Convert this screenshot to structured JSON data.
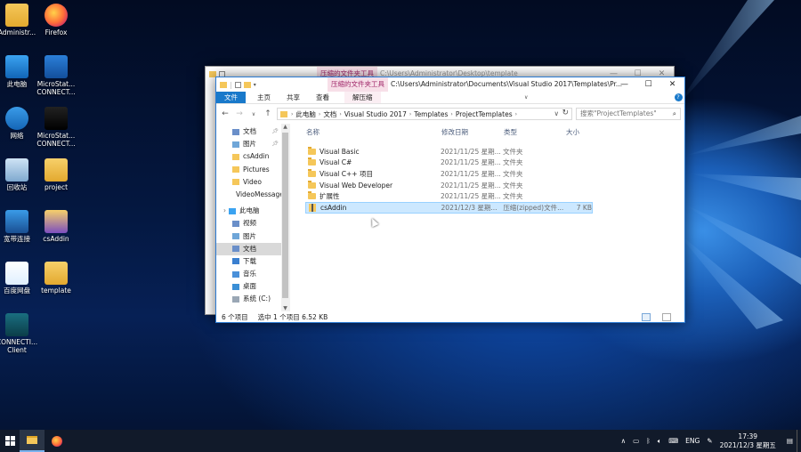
{
  "desktop": {
    "icons": [
      {
        "label": "Administr...",
        "icon": "user-folder-icon"
      },
      {
        "label": "Firefox",
        "icon": "firefox-icon"
      },
      {
        "label": "此电脑",
        "icon": "this-pc-icon"
      },
      {
        "label": "MicroStat... CONNECT...",
        "icon": "microstation-icon"
      },
      {
        "label": "网络",
        "icon": "network-icon"
      },
      {
        "label": "MicroStat... CONNECT...",
        "icon": "microstation-console-icon"
      },
      {
        "label": "回收站",
        "icon": "recycle-bin-icon"
      },
      {
        "label": "project",
        "icon": "folder-icon"
      },
      {
        "label": "宽带连接",
        "icon": "broadband-icon"
      },
      {
        "label": "csAddin",
        "icon": "zip-folder-icon"
      },
      {
        "label": "百度网盘",
        "icon": "baidu-netdisk-icon"
      },
      {
        "label": "template",
        "icon": "folder-icon"
      },
      {
        "label": "CONNECTI... Client",
        "icon": "connection-client-icon"
      }
    ]
  },
  "back_window": {
    "context_tab": "压缩的文件夹工具",
    "title": "C:\\Users\\Administrator\\Desktop\\template"
  },
  "explorer": {
    "context_tab": "压缩的文件夹工具",
    "title": "C:\\Users\\Administrator\\Documents\\Visual Studio 2017\\Templates\\Pr...",
    "controls": {
      "minimize": "—",
      "maximize": "☐",
      "close": "✕"
    },
    "ribbon_tabs": [
      "文件",
      "主页",
      "共享",
      "查看",
      "解压缩"
    ],
    "breadcrumb": [
      "此电脑",
      "文档",
      "Visual Studio 2017",
      "Templates",
      "ProjectTemplates"
    ],
    "search_placeholder": "搜索\"ProjectTemplates\"",
    "nav_items": [
      {
        "label": "文档",
        "pinned": true
      },
      {
        "label": "图片",
        "pinned": true
      },
      {
        "label": "csAddin",
        "pinned": false
      },
      {
        "label": "Pictures",
        "pinned": false
      },
      {
        "label": "Video",
        "pinned": false
      },
      {
        "label": "VideoMessage",
        "pinned": false
      },
      {
        "label": "此电脑",
        "pinned": false
      },
      {
        "label": "视频",
        "pinned": false
      },
      {
        "label": "图片",
        "pinned": false
      },
      {
        "label": "文档",
        "pinned": false
      },
      {
        "label": "下载",
        "pinned": false
      },
      {
        "label": "音乐",
        "pinned": false
      },
      {
        "label": "桌面",
        "pinned": false
      },
      {
        "label": "系统 (C:)",
        "pinned": false
      }
    ],
    "columns": [
      "名称",
      "修改日期",
      "类型",
      "大小"
    ],
    "files": [
      {
        "name": "Visual Basic",
        "date": "2021/11/25 星期...",
        "type": "文件夹",
        "size": ""
      },
      {
        "name": "Visual C#",
        "date": "2021/11/25 星期...",
        "type": "文件夹",
        "size": ""
      },
      {
        "name": "Visual C++ 项目",
        "date": "2021/11/25 星期...",
        "type": "文件夹",
        "size": ""
      },
      {
        "name": "Visual Web Developer",
        "date": "2021/11/25 星期...",
        "type": "文件夹",
        "size": ""
      },
      {
        "name": "扩展性",
        "date": "2021/11/25 星期...",
        "type": "文件夹",
        "size": ""
      },
      {
        "name": "csAddin",
        "date": "2021/12/3 星期...",
        "type": "压缩(zipped)文件...",
        "size": "7 KB"
      }
    ],
    "status": {
      "count": "6 个项目",
      "selection": "选中 1 个项目 6.52 KB"
    }
  },
  "taskbar": {
    "tray_lang": "ENG",
    "time": "17:39",
    "date": "2021/12/3 星期五"
  }
}
